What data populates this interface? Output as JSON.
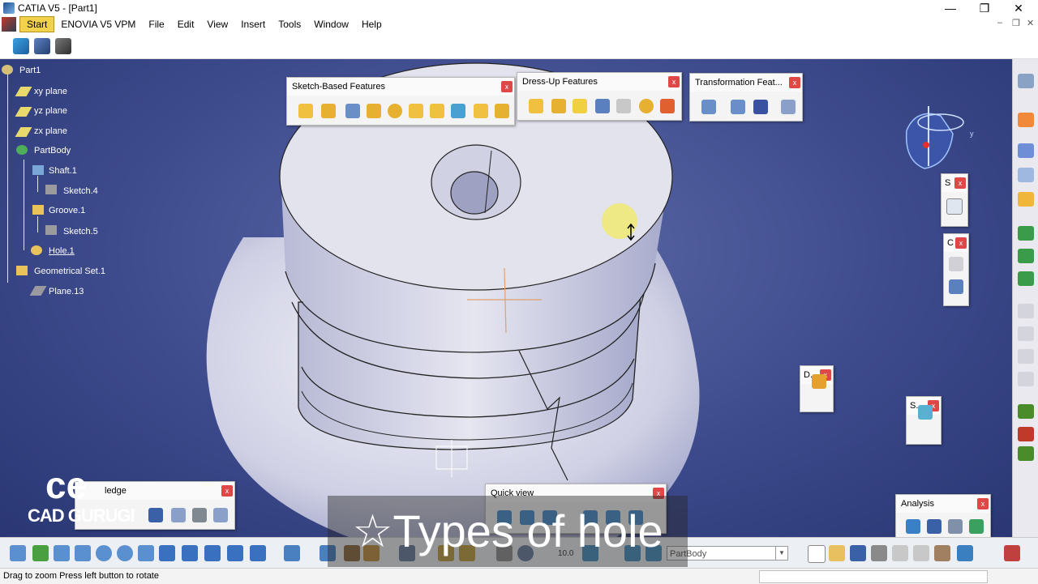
{
  "window": {
    "title": "CATIA V5 - [Part1]"
  },
  "menubar": {
    "items": [
      "Start",
      "ENOVIA V5 VPM",
      "File",
      "Edit",
      "View",
      "Insert",
      "Tools",
      "Window",
      "Help"
    ]
  },
  "tree": {
    "nodes": [
      "Part1",
      "xy plane",
      "yz plane",
      "zx plane",
      "PartBody",
      "Shaft.1",
      "Sketch.4",
      "Groove.1",
      "Sketch.5",
      "Hole.1",
      "Geometrical Set.1",
      "Plane.13"
    ]
  },
  "panels": {
    "sketch_based": {
      "title": "Sketch-Based Features",
      "close": "x"
    },
    "dress_up": {
      "title": "Dress-Up Features",
      "close": "x"
    },
    "transformation": {
      "title": "Transformation Feat...",
      "close": "x"
    },
    "knowledge": {
      "title": "ledge",
      "close": "x"
    },
    "quick_view": {
      "title": "Quick view",
      "close": "x"
    },
    "analysis": {
      "title": "Analysis",
      "close": "x"
    },
    "mini_s1": {
      "title": "S",
      "close": "x"
    },
    "mini_c": {
      "title": "C",
      "close": "x"
    },
    "mini_d": {
      "title": "D.",
      "close": "x"
    },
    "mini_s2": {
      "title": "S.",
      "close": "x"
    }
  },
  "bottom_toolbar": {
    "body_combo": "PartBody",
    "scale_readout": "10.0"
  },
  "status_bar": {
    "text": "Drag to zoom  Press left button to rotate"
  },
  "overlay": {
    "caption": "☆Types of hole",
    "watermark_logo": "ce",
    "watermark_name": "CAD GURUGI"
  },
  "colors": {
    "accent_start": "#f2d24a",
    "close_button": "#e04848",
    "viewport_bg": "#3d4a8c"
  }
}
